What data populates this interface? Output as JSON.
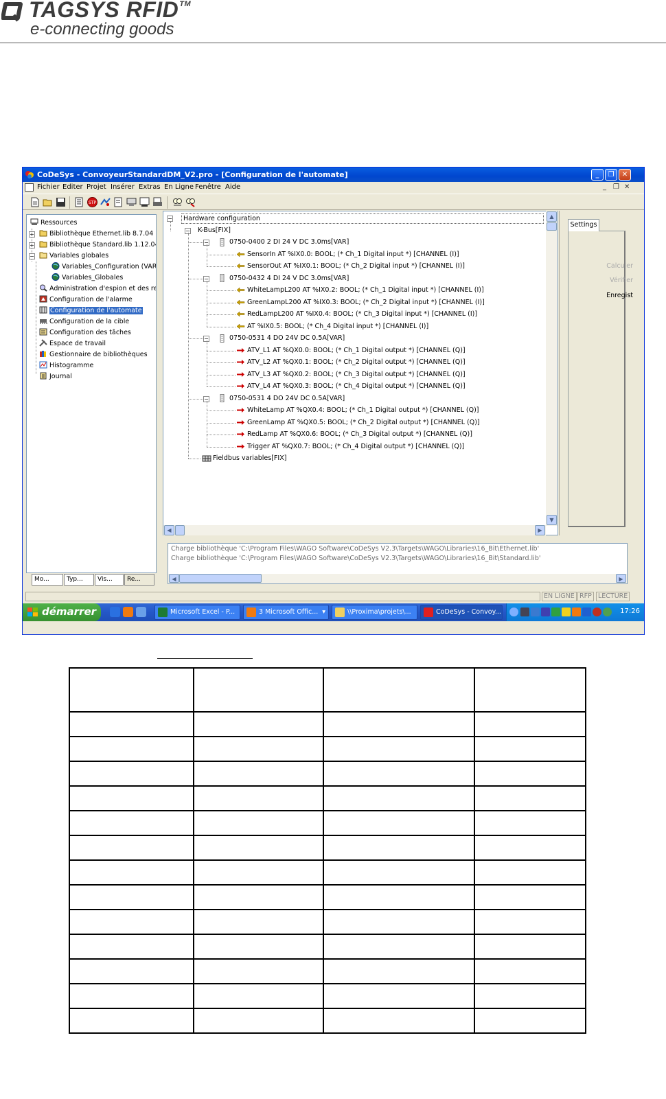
{
  "document": {
    "logo": {
      "brand": "TAGSYS RFID",
      "trademark": "TM",
      "tagline": "e-connecting goods"
    }
  },
  "window": {
    "title": "CoDeSys - ConvoyeurStandardDM_V2.pro - [Configuration de l'automate]",
    "title_buttons": [
      "_",
      "❐",
      "✕"
    ],
    "mdi_buttons": [
      "_",
      "❐",
      "✕"
    ]
  },
  "menu": [
    "Fichier",
    "Editer",
    "Projet",
    "Insérer",
    "Extras",
    "En Ligne",
    "Fenêtre",
    "Aide"
  ],
  "toolbar": {
    "icons": [
      "new-file-icon",
      "open-folder-icon",
      "save-icon",
      "build-icon",
      "stop-icon",
      "run-icon",
      "step-icon",
      "login-icon",
      "logout-icon",
      "monitor-icon",
      "search-icon",
      "replace-icon"
    ]
  },
  "left_tree": {
    "items": [
      {
        "label": "Ressources",
        "icon": "resources-icon"
      },
      {
        "label": "Bibliothèque Ethernet.lib 8.7.04 10:1",
        "icon": "folder-icon"
      },
      {
        "label": "Bibliothèque Standard.lib 1.12.04 10",
        "icon": "folder-icon"
      },
      {
        "label": "Variables globales",
        "icon": "folder-open-icon"
      },
      {
        "label": "Variables_Configuration (VAR_(",
        "icon": "globe-icon"
      },
      {
        "label": "Variables_Globales",
        "icon": "globe-icon"
      },
      {
        "label": "Administration d'espion et des recet",
        "icon": "magnifier-icon"
      },
      {
        "label": "Configuration de l'alarme",
        "icon": "alarm-icon"
      },
      {
        "label": "Configuration de l'automate",
        "icon": "plc-icon"
      },
      {
        "label": "Configuration de la cible",
        "icon": "target-icon"
      },
      {
        "label": "Configuration des tâches",
        "icon": "tasks-icon"
      },
      {
        "label": "Espace de travail",
        "icon": "tools-icon"
      },
      {
        "label": "Gestionnaire de bibliothèques",
        "icon": "library-icon"
      },
      {
        "label": "Histogramme",
        "icon": "trace-icon"
      },
      {
        "label": "Journal",
        "icon": "log-icon"
      }
    ],
    "tabs": [
      "Mo...",
      "Typ...",
      "Vis...",
      "Re..."
    ]
  },
  "hardware_tree": {
    "root": "Hardware configuration",
    "bus": "K-Bus[FIX]",
    "modules": [
      {
        "label": "0750-0400 2 DI 24 V DC 3.0ms[VAR]",
        "channels": [
          {
            "label": "SensorIn AT %IX0.0: BOOL; (* Ch_1 Digital input *) [CHANNEL (I)]",
            "dir": "input"
          },
          {
            "label": "SensorOut AT %IX0.1: BOOL; (* Ch_2 Digital input *) [CHANNEL (I)]",
            "dir": "input"
          }
        ]
      },
      {
        "label": "0750-0432 4 DI 24 V DC 3.0ms[VAR]",
        "channels": [
          {
            "label": "WhiteLampL200 AT %IX0.2: BOOL; (* Ch_1 Digital input *) [CHANNEL (I)]",
            "dir": "input"
          },
          {
            "label": "GreenLampL200 AT %IX0.3: BOOL; (* Ch_2 Digital input *) [CHANNEL (I)]",
            "dir": "input"
          },
          {
            "label": "RedLampL200 AT %IX0.4: BOOL; (* Ch_3 Digital input *) [CHANNEL (I)]",
            "dir": "input"
          },
          {
            "label": "AT %IX0.5: BOOL; (* Ch_4 Digital input *) [CHANNEL (I)]",
            "dir": "input"
          }
        ]
      },
      {
        "label": "0750-0531 4 DO 24V DC 0.5A[VAR]",
        "channels": [
          {
            "label": "ATV_L1 AT %QX0.0: BOOL; (* Ch_1 Digital output *) [CHANNEL (Q)]",
            "dir": "output"
          },
          {
            "label": "ATV_L2 AT %QX0.1: BOOL; (* Ch_2 Digital output *) [CHANNEL (Q)]",
            "dir": "output"
          },
          {
            "label": "ATV_L3 AT %QX0.2: BOOL; (* Ch_3 Digital output *) [CHANNEL (Q)]",
            "dir": "output"
          },
          {
            "label": "ATV_L4 AT %QX0.3: BOOL; (* Ch_4 Digital output *) [CHANNEL (Q)]",
            "dir": "output"
          }
        ]
      },
      {
        "label": "0750-0531 4 DO 24V DC 0.5A[VAR]",
        "channels": [
          {
            "label": "WhiteLamp AT %QX0.4: BOOL; (* Ch_1 Digital output *) [CHANNEL (Q)]",
            "dir": "output"
          },
          {
            "label": "GreenLamp AT %QX0.5: BOOL; (* Ch_2 Digital output *) [CHANNEL (Q)]",
            "dir": "output"
          },
          {
            "label": "RedLamp AT %QX0.6: BOOL; (* Ch_3 Digital output *) [CHANNEL (Q)]",
            "dir": "output"
          },
          {
            "label": "Trigger AT %QX0.7: BOOL; (* Ch_4 Digital output *) [CHANNEL (Q)]",
            "dir": "output"
          }
        ]
      }
    ],
    "fieldbus": "Fieldbus variables[FIX]"
  },
  "settings": {
    "tab": "Settings",
    "buttons": [
      "Calculer",
      "Vérifier",
      "Enregist"
    ]
  },
  "messages": [
    "Charge bibliothèque 'C:\\Program Files\\WAGO Software\\CoDeSys V2.3\\Targets\\WAGO\\Libraries\\16_Bit\\Ethernet.lib'",
    "Charge bibliothèque 'C:\\Program Files\\WAGO Software\\CoDeSys V2.3\\Targets\\WAGO\\Libraries\\16_Bit\\Standard.lib'"
  ],
  "status": [
    "EN LIGNE",
    "RFP",
    "LECTURE"
  ],
  "taskbar": {
    "start": "démarrer",
    "tasks": [
      "Microsoft Excel - P...",
      "3 Microsoft Offic...",
      "\\\\Proxima\\projets\\...",
      "CoDeSys - Convoy..."
    ],
    "task_dropdown": "▾",
    "clock": "17:26"
  },
  "colors": {
    "titlebar": "#0054e3",
    "selection": "#316ac5",
    "input_arrow": "#c8a000",
    "output_arrow": "#cc0000",
    "taskbar": "#245edb",
    "start": "#3c9c35"
  },
  "doc_table": {
    "columns": 4,
    "rows": 14,
    "cells_text": []
  }
}
